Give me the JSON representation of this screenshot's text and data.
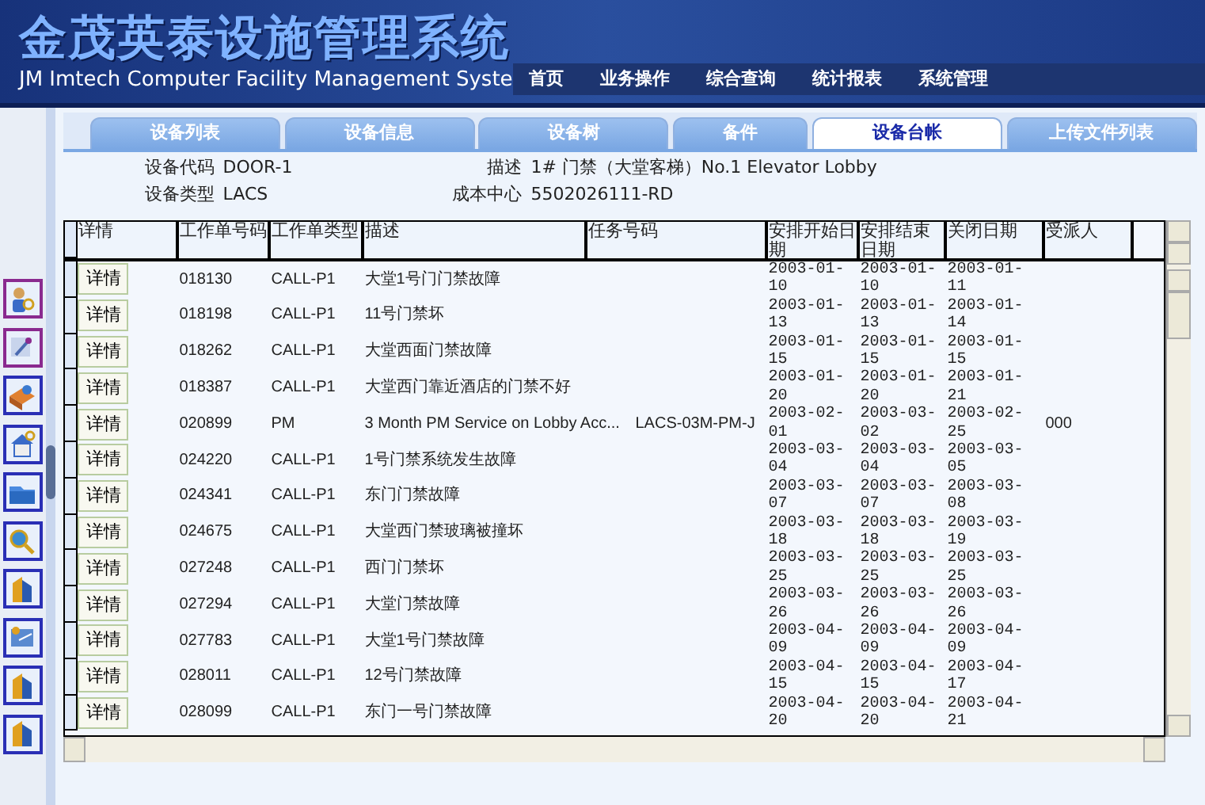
{
  "header": {
    "title": "金茂英泰设施管理系统",
    "subtitle": "JM Imtech Computer Facility Management Syste"
  },
  "nav": [
    "首页",
    "业务操作",
    "综合查询",
    "统计报表",
    "系统管理"
  ],
  "sidebar": {
    "icons": [
      {
        "kind": "person"
      },
      {
        "kind": "tools"
      },
      {
        "kind": "box"
      },
      {
        "kind": "house"
      },
      {
        "kind": "folder"
      },
      {
        "kind": "search"
      },
      {
        "kind": "building"
      },
      {
        "kind": "map"
      },
      {
        "kind": "building"
      },
      {
        "kind": "building"
      }
    ]
  },
  "tabs": [
    {
      "label": "设备列表",
      "selected": false
    },
    {
      "label": "设备信息",
      "selected": false
    },
    {
      "label": "设备树",
      "selected": false
    },
    {
      "label": "备件",
      "selected": false
    },
    {
      "label": "设备台帐",
      "selected": true
    },
    {
      "label": "上传文件列表",
      "selected": false
    }
  ],
  "info": {
    "left": [
      {
        "label": "设备代码",
        "value": "DOOR-1"
      },
      {
        "label": "设备类型",
        "value": "LACS"
      }
    ],
    "right": [
      {
        "label": "描述",
        "value": "1# 门禁（大堂客梯）No.1 Elevator Lobby"
      },
      {
        "label": "成本中心",
        "value": "5502026111-RD"
      }
    ]
  },
  "table": {
    "columns": [
      "详情",
      "工作单号码",
      "工作单类型",
      "描述",
      "任务号码",
      "安排开始日期",
      "安排结束日期",
      "关闭日期",
      "受派人"
    ],
    "rows": [
      {
        "cells": [
          "详情",
          "018130",
          "CALL-P1",
          "大堂1号门门禁故障",
          "",
          "2003-01-10",
          "2003-01-10",
          "2003-01-11",
          ""
        ]
      },
      {
        "cells": [
          "详情",
          "018198",
          "CALL-P1",
          "11号门禁坏",
          "",
          "2003-01-13",
          "2003-01-13",
          "2003-01-14",
          ""
        ]
      },
      {
        "cells": [
          "详情",
          "018262",
          "CALL-P1",
          "大堂西面门禁故障",
          "",
          "2003-01-15",
          "2003-01-15",
          "2003-01-15",
          ""
        ]
      },
      {
        "cells": [
          "详情",
          "018387",
          "CALL-P1",
          "大堂西门靠近酒店的门禁不好",
          "",
          "2003-01-20",
          "2003-01-20",
          "2003-01-21",
          ""
        ]
      },
      {
        "cells": [
          "详情",
          "020899",
          "PM",
          "3 Month PM Service on Lobby Acc...",
          "LACS-03M-PM-J",
          "2003-02-01",
          "2003-03-02",
          "2003-02-25",
          "000"
        ]
      },
      {
        "cells": [
          "详情",
          "024220",
          "CALL-P1",
          "1号门禁系统发生故障",
          "",
          "2003-03-04",
          "2003-03-04",
          "2003-03-05",
          ""
        ]
      },
      {
        "cells": [
          "详情",
          "024341",
          "CALL-P1",
          "东门门禁故障",
          "",
          "2003-03-07",
          "2003-03-07",
          "2003-03-08",
          ""
        ]
      },
      {
        "cells": [
          "详情",
          "024675",
          "CALL-P1",
          "大堂西门禁玻璃被撞坏",
          "",
          "2003-03-18",
          "2003-03-18",
          "2003-03-19",
          ""
        ]
      },
      {
        "cells": [
          "详情",
          "027248",
          "CALL-P1",
          "西门门禁坏",
          "",
          "2003-03-25",
          "2003-03-25",
          "2003-03-25",
          ""
        ]
      },
      {
        "cells": [
          "详情",
          "027294",
          "CALL-P1",
          "大堂门禁故障",
          "",
          "2003-03-26",
          "2003-03-26",
          "2003-03-26",
          ""
        ]
      },
      {
        "cells": [
          "详情",
          "027783",
          "CALL-P1",
          "大堂1号门禁故障",
          "",
          "2003-04-09",
          "2003-04-09",
          "2003-04-09",
          ""
        ]
      },
      {
        "cells": [
          "详情",
          "028011",
          "CALL-P1",
          "12号门禁故障",
          "",
          "2003-04-15",
          "2003-04-15",
          "2003-04-17",
          ""
        ]
      },
      {
        "cells": [
          "详情",
          "028099",
          "CALL-P1",
          "东门一号门禁故障",
          "",
          "2003-04-20",
          "2003-04-20",
          "2003-04-21",
          ""
        ]
      }
    ]
  }
}
